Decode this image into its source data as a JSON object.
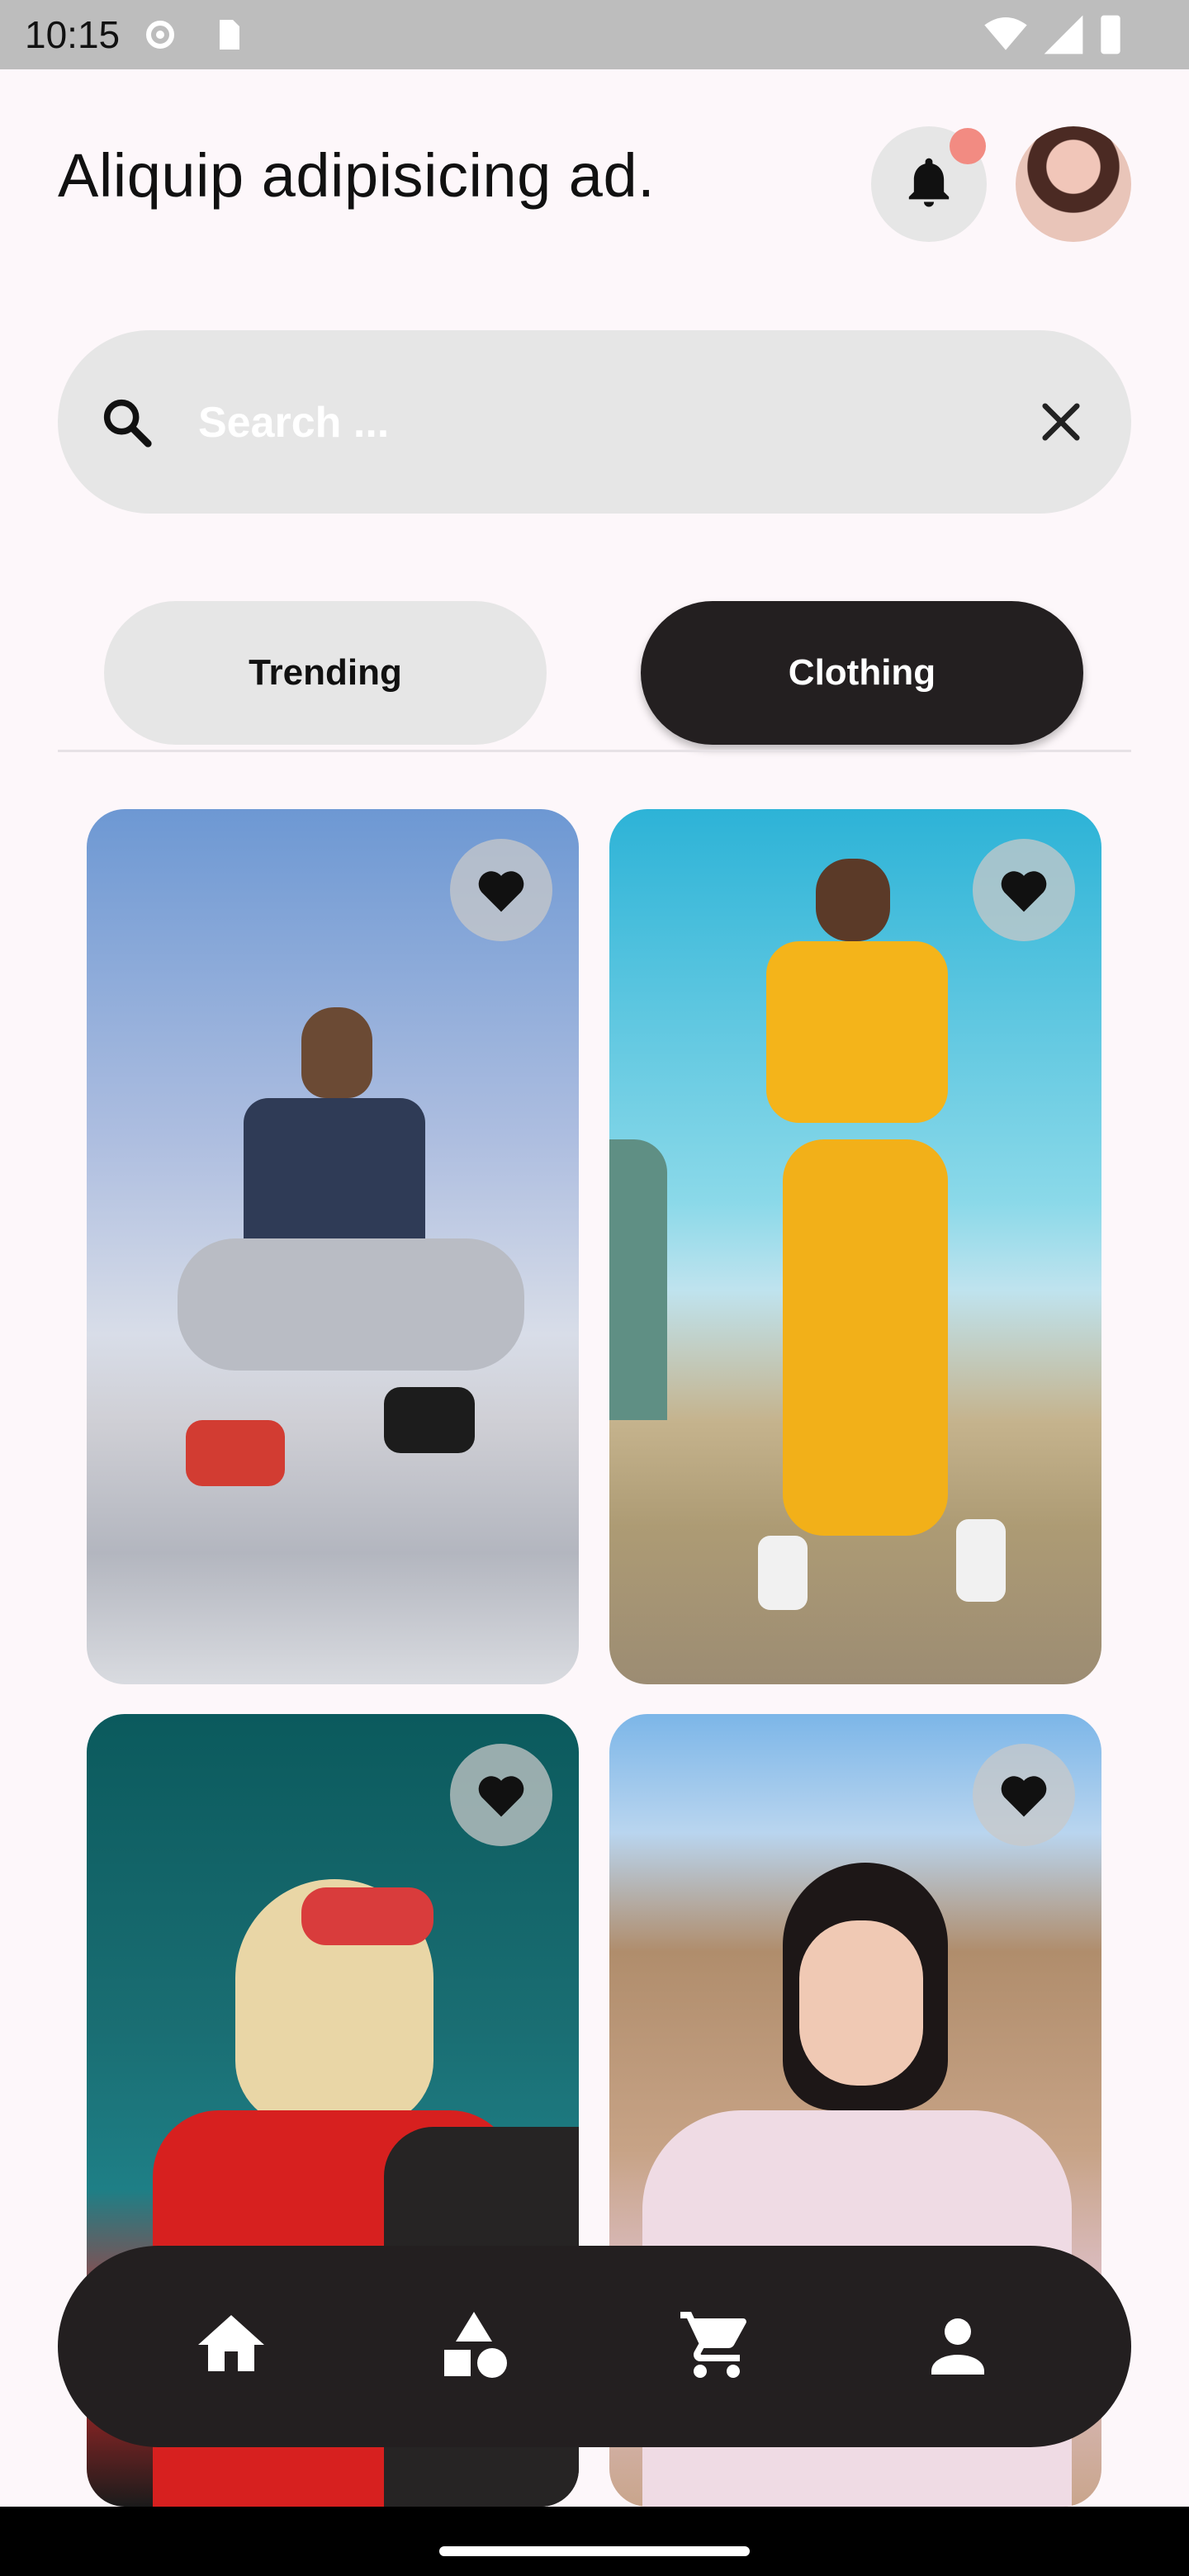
{
  "status_bar": {
    "time": "10:15"
  },
  "header": {
    "title": "Aliquip adipisicing ad."
  },
  "search": {
    "placeholder": "Search ...",
    "value": ""
  },
  "tabs": [
    {
      "label": "Trending",
      "selected": false
    },
    {
      "label": "Clothing",
      "selected": true
    }
  ],
  "products": [
    {
      "image": "woman-squatting-on-ramp",
      "favorite": true
    },
    {
      "image": "woman-yellow-tracksuit",
      "favorite": true
    },
    {
      "image": "woman-red-sunglasses-flower",
      "favorite": true
    },
    {
      "image": "woman-ruffled-dress-field",
      "favorite": true
    }
  ],
  "bottom_nav": [
    {
      "icon": "home-icon",
      "selected": true
    },
    {
      "icon": "categories-icon",
      "selected": false
    },
    {
      "icon": "cart-icon",
      "selected": false
    },
    {
      "icon": "profile-icon",
      "selected": false
    }
  ],
  "colors": {
    "background": "#FDF7FA",
    "accent_dark": "#231F20",
    "chip_light": "#E6E6E6",
    "badge": "#F28B82"
  }
}
